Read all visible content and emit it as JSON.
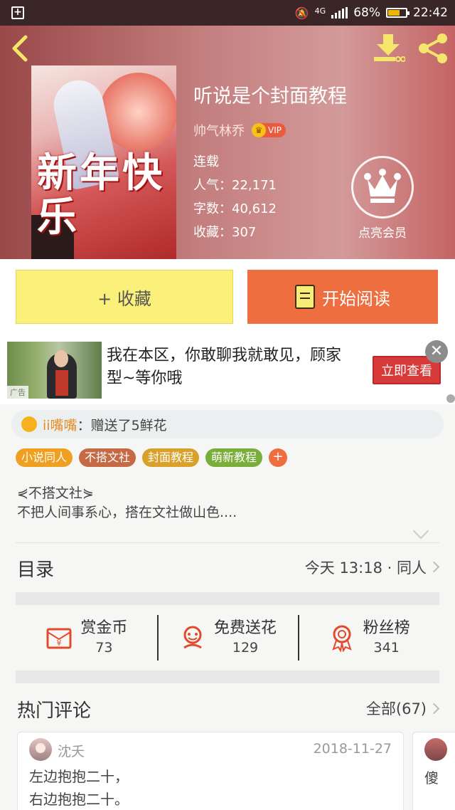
{
  "status_bar": {
    "network": "4G",
    "battery": "68%",
    "time": "22:42"
  },
  "header": {
    "back_icon": "chevron-left-icon",
    "download_icon": "download-icon",
    "share_icon": "share-icon"
  },
  "book": {
    "cover_art_text": "新年快乐",
    "title": "听说是个封面教程",
    "author": "帅气林乔",
    "vip_label": "VIP",
    "status": "连载",
    "popularity_label": "人气：",
    "popularity": "22,171",
    "words_label": "字数：",
    "words": "40,612",
    "favorites_label": "收藏：",
    "favorites": "307"
  },
  "member": {
    "label": "点亮会员",
    "icon": "crown-icon"
  },
  "actions": {
    "favorite": "+ 收藏",
    "read": "开始阅读"
  },
  "ad": {
    "tag": "广告",
    "text": "我在本区，你敢聊我就敢见，顾家型~等你哦",
    "cta": "立即查看",
    "close": "✕"
  },
  "gift": {
    "user": "ii嘴嘴",
    "text": "：赠送了5鲜花"
  },
  "tags": [
    {
      "label": "小说同人",
      "color": "#f0a020"
    },
    {
      "label": "不搭文社",
      "color": "#c46a45"
    },
    {
      "label": "封面教程",
      "color": "#d9a02a"
    },
    {
      "label": "萌新教程",
      "color": "#7aae3a"
    }
  ],
  "tag_add": "+",
  "intro": {
    "line1": "⋞不搭文社⋟",
    "line2": "不把人间事系心，搭在文社做山色...."
  },
  "toc": {
    "label": "目录",
    "latest": "今天 13:18 · 同人"
  },
  "stats": [
    {
      "title": "赏金币",
      "value": "73",
      "icon": "coin-envelope-icon"
    },
    {
      "title": "免费送花",
      "value": "129",
      "icon": "flower-icon"
    },
    {
      "title": "粉丝榜",
      "value": "341",
      "icon": "medal-icon"
    }
  ],
  "comments": {
    "label": "热门评论",
    "all": "全部(67)",
    "items": [
      {
        "user": "沈夭",
        "date": "2018-11-27",
        "line1": "左边抱抱二十，",
        "line2": "右边抱抱二十。"
      }
    ],
    "peek_text": "傻"
  },
  "colors": {
    "accent": "#ee6e3f",
    "favorite_bg": "#faf07a",
    "ad_cta": "#d83a3a"
  }
}
